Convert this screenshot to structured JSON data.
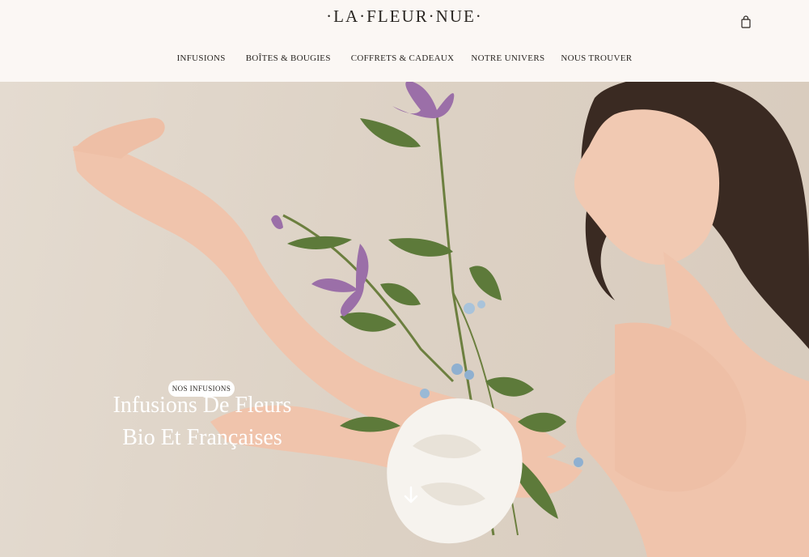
{
  "header": {
    "logo": "·LA·FLEUR·NUE·",
    "nav": [
      {
        "label": "INFUSIONS"
      },
      {
        "label": "BOÎTES & BOUGIES"
      },
      {
        "label": "COFFRETS & CADEAUX"
      },
      {
        "label": "NOTRE UNIVERS"
      },
      {
        "label": "NOUS TROUVER"
      }
    ],
    "cart_icon": "shopping-bag-icon"
  },
  "hero": {
    "title_line1": "Infusions De Fleurs",
    "title_line2": "Bio Et Françaises",
    "button_label": "NOS INFUSIONS",
    "scroll_icon": "arrow-down-icon"
  },
  "colors": {
    "header_bg": "#fbf7f4",
    "hero_bg": "#ddd2c5",
    "text": "#2a2622",
    "skin": "#f0c6ae",
    "hair": "#3a2a22",
    "petal_purple": "#9b6fa8",
    "leaf_green": "#5d7a3a",
    "peony_white": "#f6f3ee"
  }
}
